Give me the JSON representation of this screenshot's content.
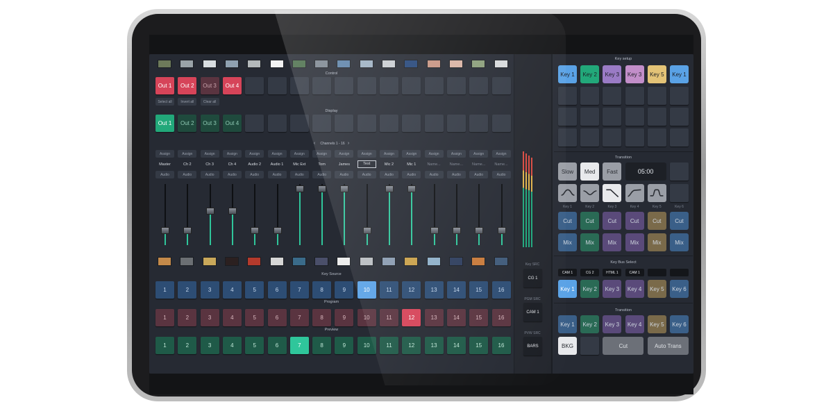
{
  "palette": {
    "red": "#d64459",
    "green": "#22a87a",
    "blue": "#5aa2e6",
    "purple": "#9a7bc5",
    "yellow": "#e3c377",
    "dark": "#343a45"
  },
  "thumbnails": {
    "colors": [
      "#6d7a5a",
      "#9aa3a8",
      "#d8dde0",
      "#8fa1b0",
      "#b4b9bb",
      "#f2f2f2",
      "#4a6e4a",
      "#7c8690",
      "#5d82a8",
      "#9db0c2",
      "#c9cdd1",
      "#25467a",
      "#c79482",
      "#d9b3a4",
      "#8b9e7a",
      "#d8dadc"
    ]
  },
  "control": {
    "title": "Control",
    "outputs": [
      "Out 1",
      "Out 2",
      "Out 3",
      "Out 4"
    ],
    "small_buttons": [
      "Select all",
      "Invert all",
      "Clear all"
    ]
  },
  "display": {
    "title": "Display",
    "outputs": [
      "Out 1",
      "Out 2",
      "Out 3",
      "Out 4"
    ]
  },
  "channels": {
    "title": "Channels 1 - 16",
    "prev_icon": "chevron-left-icon",
    "next_icon": "chevron-right-icon",
    "assign_label": "Assign",
    "audio_label": "Audio",
    "names": [
      "Master",
      "Ch 2",
      "Ch 3",
      "Ch 4",
      "Audio 2",
      "Audio 1",
      "Mic Ext",
      "Tom",
      "James",
      "Test",
      "Mic 2",
      "Mic 1",
      "Name...",
      "Name...",
      "Name...",
      "Name..."
    ],
    "fader_levels": [
      0.24,
      0.24,
      0.56,
      0.56,
      0.24,
      0.24,
      0.92,
      0.92,
      0.92,
      0.24,
      0.92,
      0.92,
      0.24,
      0.24,
      0.24,
      0.24
    ]
  },
  "source_thumbs": [
    "#c48a4a",
    "#6b6f73",
    "#c9a85a",
    "#2b2020",
    "#b43a2c",
    "#d6d6d6",
    "#3a6b8a",
    "#4a4f6a",
    "#ececec",
    "#b9bdc1",
    "#8a9bb1",
    "#caa14a",
    "#8fb0c9",
    "#2e3e5e",
    "#c87a3a",
    "#3f5a7a"
  ],
  "key_source": {
    "title": "Key Source",
    "numbers": [
      "1",
      "2",
      "3",
      "4",
      "5",
      "6",
      "7",
      "8",
      "9",
      "10",
      "11",
      "12",
      "13",
      "14",
      "15",
      "16"
    ],
    "active": "10"
  },
  "program": {
    "title": "Program",
    "numbers": [
      "1",
      "2",
      "3",
      "4",
      "5",
      "6",
      "7",
      "8",
      "9",
      "10",
      "11",
      "12",
      "13",
      "14",
      "15",
      "16"
    ],
    "active": "12"
  },
  "preview": {
    "title": "Preview",
    "numbers": [
      "1",
      "2",
      "3",
      "4",
      "5",
      "6",
      "7",
      "8",
      "9",
      "10",
      "11",
      "12",
      "13",
      "14",
      "15",
      "16"
    ],
    "active": "7"
  },
  "src": {
    "key_src_label": "Key SRC",
    "key_src_value": "CG 1",
    "pgm_src_label": "PGM SRC",
    "pgm_src_value": "CAM 1",
    "pvw_src_label": "PVW SRC",
    "pvw_src_value": "BARS"
  },
  "key_setup": {
    "title": "Key setup",
    "keys": [
      {
        "label": "Key 1",
        "color": "#5aa2e6"
      },
      {
        "label": "Key 2",
        "color": "#22a87a"
      },
      {
        "label": "Key 3",
        "color": "#9a7bc5"
      },
      {
        "label": "Key 3",
        "color": "#c28ec9"
      },
      {
        "label": "Key 5",
        "color": "#e3c377"
      },
      {
        "label": "Key 1",
        "color": "#5aa2e6"
      }
    ]
  },
  "transition1": {
    "title": "Transition",
    "speeds": [
      "Slow",
      "Med",
      "Fast"
    ],
    "active_speed": "Med",
    "duration": "05:00",
    "curve_icons": [
      "ease-in-out-icon",
      "ease-dip-icon",
      "ease-linear-drop-icon",
      "ease-out-icon",
      "ease-plateau-icon"
    ],
    "key_labels": [
      "Key 1",
      "Key 2",
      "Key 3",
      "Key 4",
      "Key 5",
      "Key 6"
    ],
    "cut_label": "Cut",
    "mix_label": "Mix"
  },
  "key_bus": {
    "title": "Key Bus Select",
    "sources": [
      "CAM 1",
      "CG 2",
      "HTML 1",
      "CAM 1"
    ],
    "keys": [
      "Key 1",
      "Key 2",
      "Key 3",
      "Key 4",
      "Key 5",
      "Key 6"
    ]
  },
  "transition2": {
    "title": "Transition",
    "keys": [
      "Key 1",
      "Key 2",
      "Key 3",
      "Key 4",
      "Key 5",
      "Key 6"
    ],
    "bkg": "BKG",
    "cut": "Cut",
    "auto": "Auto Trans"
  }
}
